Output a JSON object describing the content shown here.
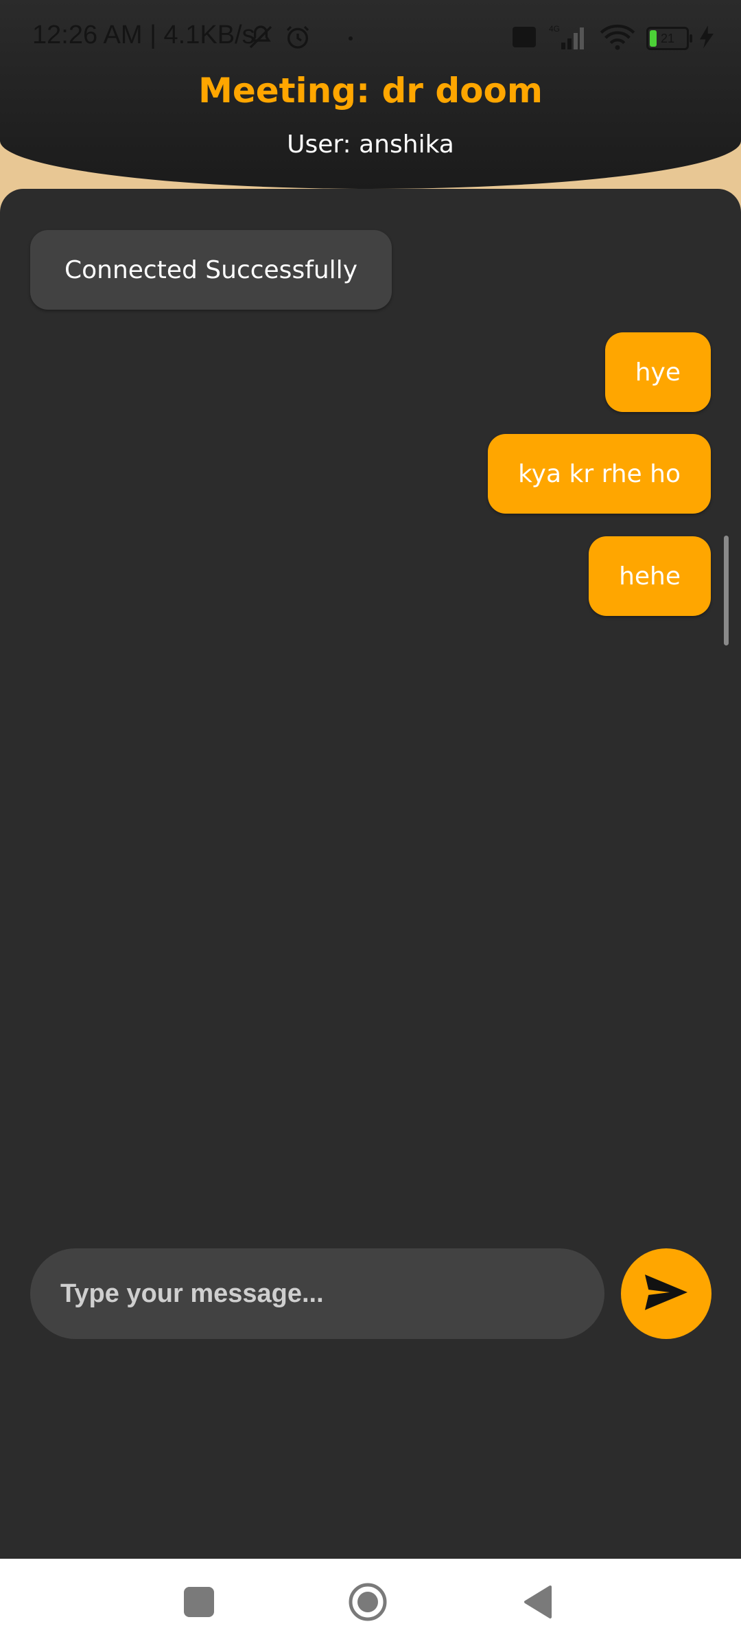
{
  "status_bar": {
    "time_speed": "12:26 AM | 4.1KB/s",
    "network": "4G",
    "battery": "21"
  },
  "header": {
    "title": "Meeting: dr doom",
    "subtitle": "User: anshika"
  },
  "messages": [
    {
      "type": "system",
      "text": "Connected Successfully"
    },
    {
      "type": "outgoing",
      "text": "hye"
    },
    {
      "type": "outgoing",
      "text": "kya kr rhe ho"
    },
    {
      "type": "outgoing",
      "text": "hehe"
    }
  ],
  "composer": {
    "placeholder": "Type your message...",
    "send_icon": "send-icon"
  },
  "colors": {
    "accent": "#ffa600",
    "panel": "#2c2c2c",
    "bubble_system": "#424242",
    "header_bg": "#1f1f1f",
    "top_band": "#e8c794"
  }
}
